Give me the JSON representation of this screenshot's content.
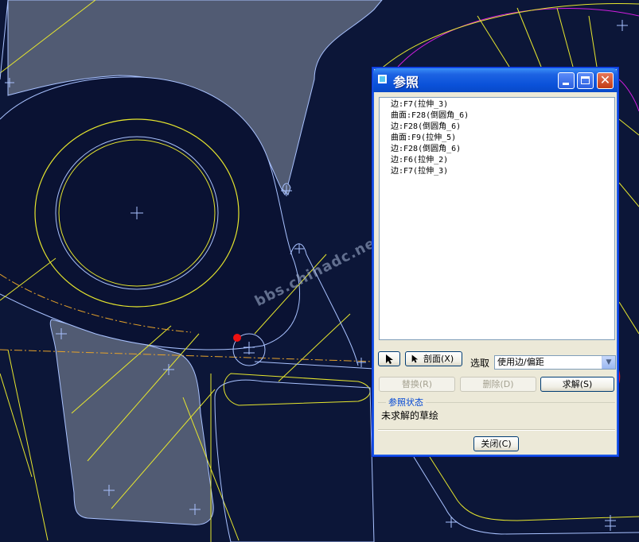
{
  "watermark": "bbs.chinadc.net",
  "dialog": {
    "title": "参照",
    "references": [
      "边:F7(拉伸_3)",
      "曲面:F28(倒圆角_6)",
      "边:F28(倒圆角_6)",
      "曲面:F9(拉伸_5)",
      "边:F28(倒圆角_6)",
      "边:F6(拉伸_2)",
      "边:F7(拉伸_3)"
    ],
    "cursor_icon": "arrow-cursor-icon",
    "section_label": "剖面(X)",
    "select_label": "选取",
    "select_value": "使用边/偏距",
    "replace_label": "替换(R)",
    "delete_label": "删除(D)",
    "solve_label": "求解(S)",
    "status_group": "参照状态",
    "status_text": "未求解的草绘",
    "close_label": "关闭(C)"
  },
  "colors": {
    "background": "#0c1638",
    "sketch_line": "#e6e62e",
    "edge_line": "#a9c2ff",
    "arc_magenta": "#d11ee0",
    "centerline": "#e5a22a",
    "highlight_ellipse": "#e0161c"
  }
}
